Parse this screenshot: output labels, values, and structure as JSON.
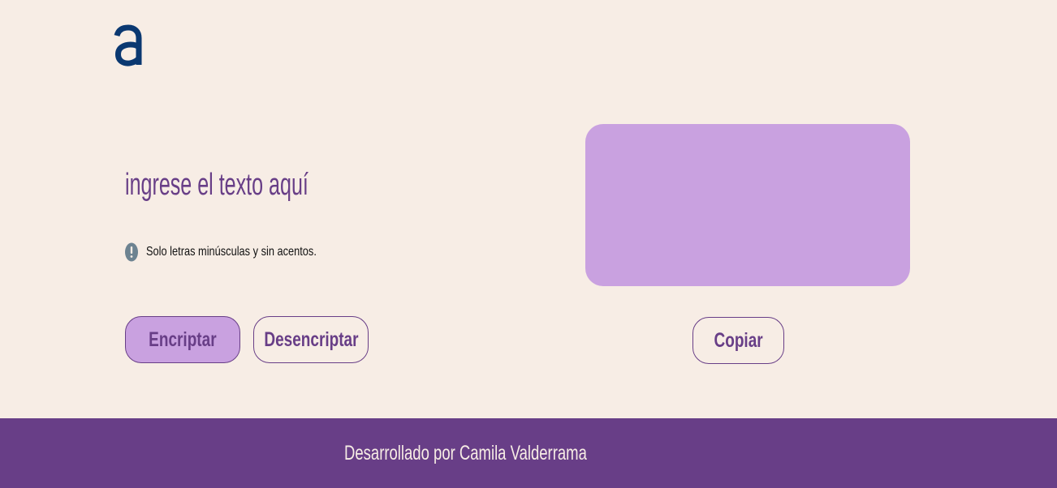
{
  "header": {
    "logo_icon": "alura-a-logo-icon"
  },
  "input": {
    "text": "ingrese el texto aquí"
  },
  "hint": {
    "icon": "exclamation-circle-icon",
    "text": "Solo letras minúsculas y sin acentos."
  },
  "actions": {
    "encrypt_label": "Encriptar",
    "decrypt_label": "Desencriptar",
    "copy_label": "Copiar"
  },
  "output": {
    "text": ""
  },
  "footer": {
    "text": "Desarrollado por Camila Valderrama"
  },
  "colors": {
    "background": "#f7ede5",
    "primary": "#683e87",
    "accent": "#c9a1e0",
    "logo": "#0a3871",
    "hint_icon": "#6d8391"
  }
}
